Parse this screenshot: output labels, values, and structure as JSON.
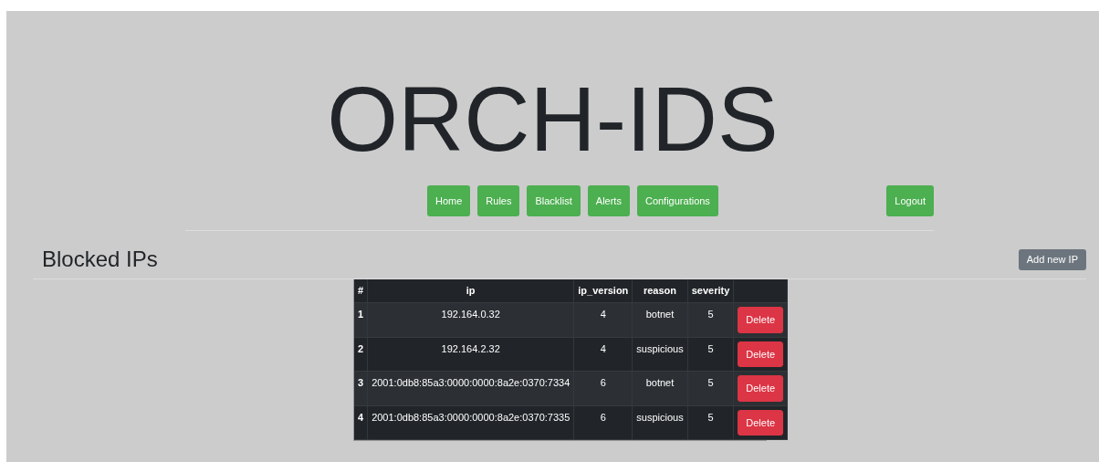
{
  "title": "ORCH-IDS",
  "nav": [
    {
      "label": "Home"
    },
    {
      "label": "Rules"
    },
    {
      "label": "Blacklist"
    },
    {
      "label": "Alerts"
    },
    {
      "label": "Configurations"
    }
  ],
  "logout": "Logout",
  "heading": "Blocked IPs",
  "add_button": "Add new IP",
  "table": {
    "columns": [
      "#",
      "ip",
      "ip_version",
      "reason",
      "severity"
    ],
    "rows": [
      {
        "cells": [
          "1",
          "192.164.0.32",
          "4",
          "botnet",
          "5"
        ],
        "action": "Delete"
      },
      {
        "cells": [
          "2",
          "192.164.2.32",
          "4",
          "suspicious",
          "5"
        ],
        "action": "Delete"
      },
      {
        "cells": [
          "3",
          "2001:0db8:85a3:0000:0000:8a2e:0370:7334",
          "6",
          "botnet",
          "5"
        ],
        "action": "Delete"
      },
      {
        "cells": [
          "4",
          "2001:0db8:85a3:0000:0000:8a2e:0370:7335",
          "6",
          "suspicious",
          "5"
        ],
        "action": "Delete"
      }
    ]
  }
}
